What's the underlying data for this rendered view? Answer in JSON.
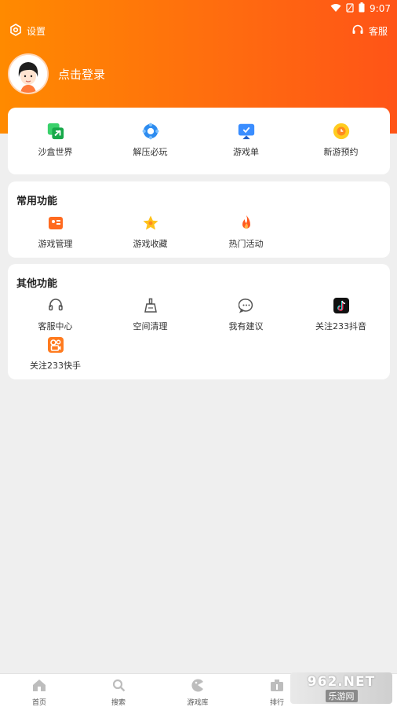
{
  "status_bar": {
    "time": "9:07"
  },
  "topbar": {
    "settings_label": "设置",
    "service_label": "客服"
  },
  "profile": {
    "login_label": "点击登录"
  },
  "quick_entries": [
    {
      "label": "沙盒世界",
      "icon": "sandbox-icon",
      "color": "#2fbf5b"
    },
    {
      "label": "解压必玩",
      "icon": "decompress-icon",
      "color": "#2d8cf0"
    },
    {
      "label": "游戏单",
      "icon": "game-list-icon",
      "color": "#3a8dff"
    },
    {
      "label": "新游预约",
      "icon": "reserve-icon",
      "color": "#ffcc1f"
    }
  ],
  "common_functions": {
    "title": "常用功能",
    "items": [
      {
        "label": "游戏管理",
        "icon": "game-manage-icon",
        "color": "#ff6a1f"
      },
      {
        "label": "游戏收藏",
        "icon": "star-icon",
        "color": "#ffc21a"
      },
      {
        "label": "热门活动",
        "icon": "fire-icon",
        "color": "#ff5a1f"
      }
    ]
  },
  "other_functions": {
    "title": "其他功能",
    "items": [
      {
        "label": "客服中心",
        "icon": "headset-icon"
      },
      {
        "label": "空间清理",
        "icon": "broom-icon"
      },
      {
        "label": "我有建议",
        "icon": "chat-icon"
      },
      {
        "label": "关注233抖音",
        "icon": "douyin-icon"
      },
      {
        "label": "关注233快手",
        "icon": "kuaishou-icon"
      }
    ]
  },
  "bottom_nav": [
    {
      "label": "首页",
      "icon": "home-icon"
    },
    {
      "label": "搜索",
      "icon": "search-icon"
    },
    {
      "label": "游戏库",
      "icon": "game-library-icon"
    },
    {
      "label": "排行",
      "icon": "ranking-icon"
    }
  ],
  "watermark": {
    "brand": "962.NET",
    "sub": "乐游网"
  },
  "colors": {
    "header_start": "#ff8a00",
    "header_end": "#ff5417",
    "page_bg": "#efefef"
  }
}
